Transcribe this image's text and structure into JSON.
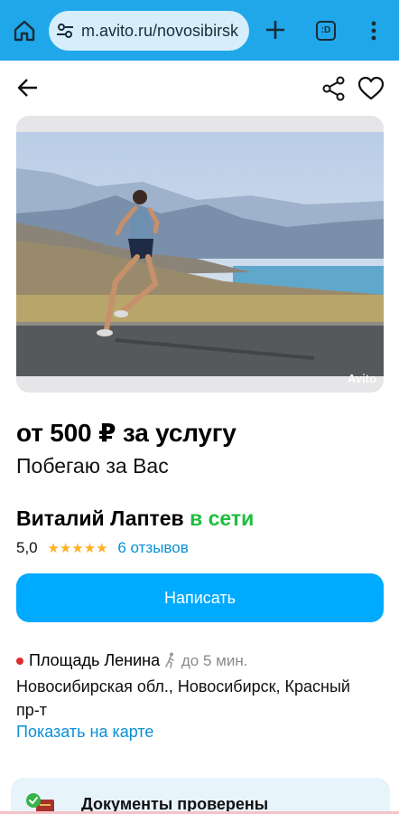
{
  "browser": {
    "url": "m.avito.ru/novosibirsk",
    "tabs_label": ":D",
    "icons": [
      "home-icon",
      "tune-icon",
      "plus-icon",
      "tabs-icon",
      "menu-icon"
    ]
  },
  "header": {
    "icons": [
      "back-arrow-icon",
      "share-icon",
      "heart-icon"
    ]
  },
  "photo": {
    "watermark": "Avito"
  },
  "listing": {
    "price": "от 500 ₽ за услугу",
    "title": "Побегаю за Вас"
  },
  "seller": {
    "name": "Виталий Лаптев",
    "status": "в сети",
    "rating": "5,0",
    "stars": "★★★★★",
    "reviews": "6 отзывов"
  },
  "actions": {
    "write_label": "Написать"
  },
  "location": {
    "metro": "Площадь Ленина",
    "walk_time": "до 5 мин.",
    "address": "Новосибирская обл., Новосибирск, Красный пр-т",
    "map_link": "Показать на карте"
  },
  "docs": {
    "label": "Документы проверены"
  },
  "colors": {
    "browser_bar": "#1fa7ea",
    "primary_button": "#00aaff",
    "online": "#1dbf3c",
    "link": "#0a8fd8",
    "stars": "#ffb021",
    "metro_dot": "#e02b2b"
  }
}
